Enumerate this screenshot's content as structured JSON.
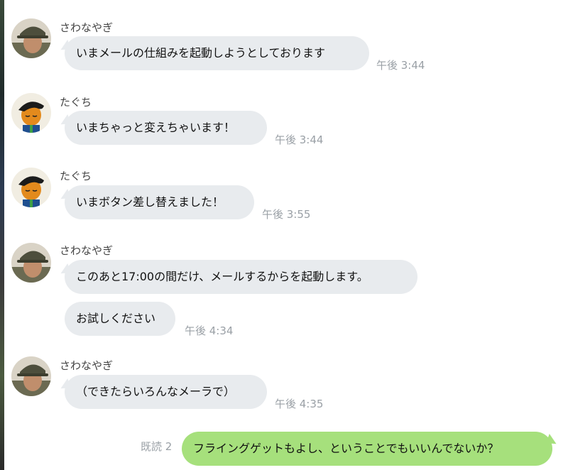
{
  "messages": [
    {
      "sender": "さわなやぎ",
      "avatar": "avatar-sawanayagi",
      "text": "いまメールの仕組みを起動しようとしております",
      "time": "午後 3:44"
    },
    {
      "sender": "たぐち",
      "avatar": "avatar-taguchi",
      "text": "いまちゃっと変えちゃいます！",
      "time": "午後 3:44"
    },
    {
      "sender": "たぐち",
      "avatar": "avatar-taguchi",
      "text": "いまボタン差し替えました！",
      "time": "午後 3:55"
    },
    {
      "sender": "さわなやぎ",
      "avatar": "avatar-sawanayagi",
      "text": "このあと17:00の間だけ、メールするからを起動します。",
      "time": ""
    },
    {
      "sender": "",
      "avatar": "",
      "text": "お試しください",
      "time": "午後 4:34"
    },
    {
      "sender": "さわなやぎ",
      "avatar": "avatar-sawanayagi",
      "text": "（できたらいろんなメーラで）",
      "time": "午後 4:35"
    }
  ],
  "my_message": {
    "text": "フライングゲットもよし、ということでもいいんでないか？",
    "read": "既読 2"
  },
  "colors": {
    "incoming_bubble": "#e8ebee",
    "outgoing_bubble": "#a6e07c",
    "meta_text": "#9aa0a6"
  }
}
